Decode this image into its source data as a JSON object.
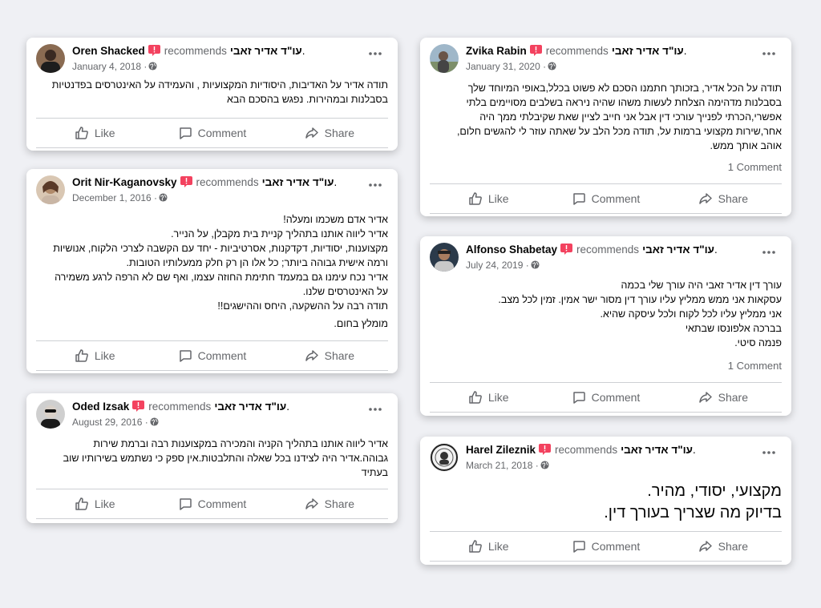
{
  "recommend_word": "recommends",
  "page_name": "עו\"ד אדיר זאבי",
  "period": ".",
  "actions": {
    "like": "Like",
    "comment": "Comment",
    "share": "Share"
  },
  "posts": [
    {
      "author": "Oren Shacked",
      "date": "January 4, 2018 ·",
      "lines": [
        "תודה אדיר על האדיבות, היסודיות המקצועיות , והעמידה על האינטרסים בפדנטיות",
        "בסבלנות ובמהירות. נפגש בהסכם הבא"
      ],
      "comments": ""
    },
    {
      "author": "Orit Nir-Kaganovsky",
      "date": "December 1, 2016 ·",
      "lines": [
        "אדיר אדם משכמו ומעלה!",
        "אדיר ליווה אותנו בתהליך קניית בית מקבלן, על הנייר.",
        "מקצוענות, יסודיות, דקדקנות, אסרטיביות - יחד עם הקשבה לצרכי הלקוח, אנושיות",
        "ורמה אישית גבוהה ביותר; כל אלו הן רק חלק ממעלותיו הטובות.",
        "אדיר נכח עימנו גם במעמד חתימת החוזה עצמו, ואף שם לא הרפה לרגע משמירה",
        "על האינטרסים שלנו.",
        "תודה רבה על ההשקעה, היחס וההישגים!!",
        "מומלץ בחום."
      ],
      "comments": ""
    },
    {
      "author": "Oded Izsak",
      "date": "August 29, 2016 ·",
      "lines": [
        "אדיר ליווה אותנו בתהליך הקניה והמכירה במקצוענות רבה וברמת שירות",
        "גבוהה.אדיר היה לצידנו בכל שאלה והתלבטות.אין ספק כי נשתמש בשירותיו שוב",
        "בעתיד"
      ],
      "comments": ""
    },
    {
      "author": "Zvika Rabin",
      "date": "January 31, 2020 ·",
      "lines": [
        "תודה על הכל אדיר, בזכותך חתמנו הסכם לא פשוט בכלל,באופי המיוחד שלך",
        "בסבלנות מדהימה הצלחת לעשות משהו שהיה ניראה בשלבים מסויימים בלתי",
        "אפשרי,הכרתי לפנייך עורכי דין אבל אני חייב לציין שאת שקיבלתי ממך היה",
        "אחר,שירות מקצועי ברמות על, תודה מכל הלב על שאתה עוזר לי להגשים חלום,",
        "אוהב אותך ממש."
      ],
      "comments": "1 Comment"
    },
    {
      "author": "Alfonso Shabetay",
      "date": "July 24, 2019 ·",
      "lines": [
        "עורך דין אדיר זאבי היה עורך שלי בכמה",
        "עסקאות אני ממש ממליץ עליו עורך דין מסור ישר אמין. זמין לכל מצב.",
        "אני ממליץ עליו לכל לקוח ולכל עיסקה שהיא.",
        "בברכה אלפונסו שבתאי",
        "פנמה סיטי."
      ],
      "comments": "1 Comment"
    },
    {
      "author": "Harel Zileznik",
      "date": "March 21, 2018 ·",
      "lines": [
        "מקצועי, יסודי, מהיר.",
        "בדיוק מה שצריך בעורך דין."
      ],
      "comments": ""
    }
  ]
}
